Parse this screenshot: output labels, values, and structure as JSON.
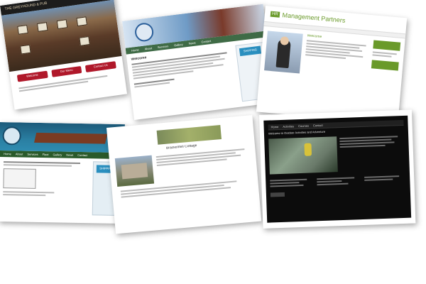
{
  "cards": {
    "pub": {
      "header_title": "THE GREYHOUND & PUB",
      "buttons": [
        "Welcome",
        "Our Menu",
        "Contact Us"
      ]
    },
    "port": {
      "nav_items": [
        "Home",
        "About",
        "Services",
        "Gallery",
        "News",
        "Contact"
      ],
      "heading": "Welcome",
      "side_logo": "SHIPPING"
    },
    "hr": {
      "logo_text": "HR",
      "title": "Management Partners",
      "heading": "Welcome"
    },
    "ships": {
      "nav_items": [
        "Home",
        "About",
        "Services",
        "Fleet",
        "Gallery",
        "News",
        "Contact"
      ],
      "side_logo": "SHIPPING"
    },
    "cottage": {
      "title": "Brackenfell Cottage"
    },
    "adventure": {
      "nav_items": [
        "Home",
        "Activities",
        "Courses",
        "Contact"
      ],
      "heading": "Welcome to Outdoor Activities and Adventure"
    }
  }
}
